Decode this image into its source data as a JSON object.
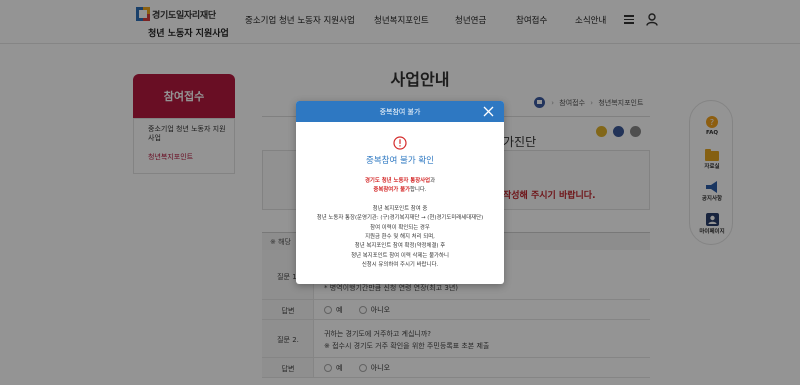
{
  "header": {
    "logo_title": "경기도일자리재단",
    "logo_subtitle": "청년 노동자 지원사업",
    "nav": [
      {
        "label": "중소기업 청년 노동자 지원사업"
      },
      {
        "label": "청년복지포인트"
      },
      {
        "label": "청년연금"
      },
      {
        "label": "참여접수"
      },
      {
        "label": "소식안내"
      }
    ]
  },
  "page": {
    "title": "사업안내",
    "breadcrumb": [
      "참여접수",
      "청년복지포인트"
    ]
  },
  "sidebar": {
    "heading": "참여접수",
    "items": [
      {
        "label": "중소기업 청년 노동자 지원사업"
      },
      {
        "label": "청년복지포인트"
      }
    ]
  },
  "quick_menu": {
    "items": [
      {
        "label": "FAQ"
      },
      {
        "label": "자료실"
      },
      {
        "label": "공지사항"
      },
      {
        "label": "마이페이지"
      }
    ]
  },
  "background": {
    "heading_suffix": "가진단",
    "red_notice_suffix": "작성해 주시기 바랍니다.",
    "note": "※ 해당",
    "question_label": "질문 1.",
    "q1_text_partial": "* 병역이행기간만큼 신청 연령 연장(최고 3년)",
    "answer_label": "답변",
    "q2_label": "질문 2.",
    "q2_line1": "귀하는 경기도에 거주하고 계십니까?",
    "q2_line2": "※ 접수시 경기도 거주 확인을 위한 주민등록표 초본 제출",
    "yes": "예",
    "no": "아니오"
  },
  "modal": {
    "title": "중복참여 불가",
    "subtitle": "중복참여 불가 확인",
    "line1_red": "경기도 청년 노동자 통장사업",
    "line1_rest": "과",
    "line2_red": "중복참여가 불가",
    "line2_rest": "합니다.",
    "line3": "청년 복지포인트 참여 중",
    "line4": "청년 노동자 통장(운영기관: (구)경기복지재단 → (현)경기도미래세대재단)",
    "line5": "참여 이력이 확인되는 경우",
    "line6": "지원금 환수 및 해지 처리 되며,",
    "line7": "청년 복지포인트 참여 확정(약정체결) 후",
    "line8": "청년 복지포인트 참여 이력 삭제는 불가하니",
    "line9": "신청시 유의하여 주시기 바랍니다."
  },
  "colors": {
    "brand_red": "#b5193f",
    "modal_blue": "#2e78c2",
    "alert_red": "#d42a2a"
  }
}
